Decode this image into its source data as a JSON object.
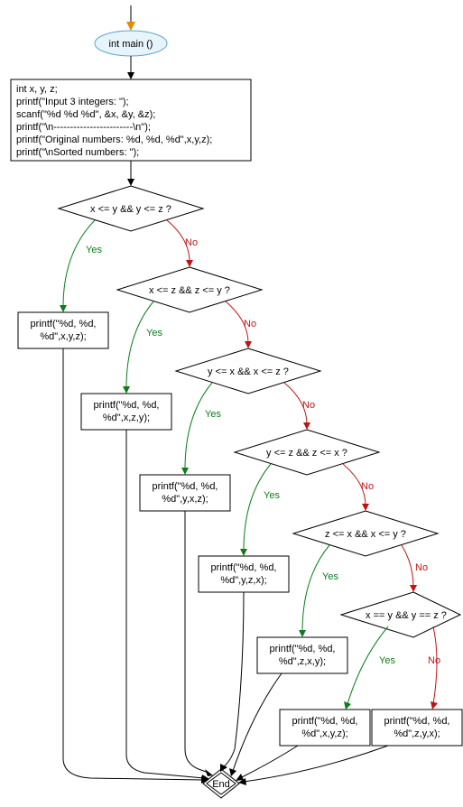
{
  "chart_data": {
    "type": "flowchart",
    "nodes": {
      "start": {
        "shape": "ellipse",
        "text": "int main ()"
      },
      "init": {
        "shape": "rect",
        "text": "int x, y, z;\nprintf(\"Input 3 integers: \");\nscanf(\"%d %d %d\", &x, &y, &z);\nprintf(\"\\n------------------------\\n\");\nprintf(\"Original numbers: %d, %d, %d\",x,y,z);\nprintf(\"\\nSorted numbers: \");"
      },
      "d1": {
        "shape": "diamond",
        "text": "x <= y && y <= z ?"
      },
      "d2": {
        "shape": "diamond",
        "text": "x <= z && z <= y ?"
      },
      "d3": {
        "shape": "diamond",
        "text": "y <= x && x <= z ?"
      },
      "d4": {
        "shape": "diamond",
        "text": "y <= z && z <= x ?"
      },
      "d5": {
        "shape": "diamond",
        "text": "z <= x && x <= y ?"
      },
      "d6": {
        "shape": "diamond",
        "text": "x == y && y == z ?"
      },
      "p1": {
        "shape": "rect",
        "text": "printf(\"%d, %d,\n%d\",x,y,z);"
      },
      "p2": {
        "shape": "rect",
        "text": "printf(\"%d, %d,\n%d\",x,z,y);"
      },
      "p3": {
        "shape": "rect",
        "text": "printf(\"%d, %d,\n%d\",y,x,z);"
      },
      "p4": {
        "shape": "rect",
        "text": "printf(\"%d, %d,\n%d\",y,z,x);"
      },
      "p5": {
        "shape": "rect",
        "text": "printf(\"%d, %d,\n%d\",z,x,y);"
      },
      "p6": {
        "shape": "rect",
        "text": "printf(\"%d, %d,\n%d\",x,y,z);"
      },
      "p7": {
        "shape": "rect",
        "text": "printf(\"%d, %d,\n%d\",z,y,x);"
      },
      "end": {
        "shape": "diamond-small",
        "text": "End"
      }
    },
    "edges": [
      {
        "from": "entry",
        "to": "start",
        "label": ""
      },
      {
        "from": "start",
        "to": "init",
        "label": ""
      },
      {
        "from": "init",
        "to": "d1",
        "label": ""
      },
      {
        "from": "d1",
        "to": "p1",
        "label": "Yes"
      },
      {
        "from": "d1",
        "to": "d2",
        "label": "No"
      },
      {
        "from": "d2",
        "to": "p2",
        "label": "Yes"
      },
      {
        "from": "d2",
        "to": "d3",
        "label": "No"
      },
      {
        "from": "d3",
        "to": "p3",
        "label": "Yes"
      },
      {
        "from": "d3",
        "to": "d4",
        "label": "No"
      },
      {
        "from": "d4",
        "to": "p4",
        "label": "Yes"
      },
      {
        "from": "d4",
        "to": "d5",
        "label": "No"
      },
      {
        "from": "d5",
        "to": "p5",
        "label": "Yes"
      },
      {
        "from": "d5",
        "to": "d6",
        "label": "No"
      },
      {
        "from": "d6",
        "to": "p6",
        "label": "Yes"
      },
      {
        "from": "d6",
        "to": "p7",
        "label": "No"
      },
      {
        "from": "p1",
        "to": "end",
        "label": ""
      },
      {
        "from": "p2",
        "to": "end",
        "label": ""
      },
      {
        "from": "p3",
        "to": "end",
        "label": ""
      },
      {
        "from": "p4",
        "to": "end",
        "label": ""
      },
      {
        "from": "p5",
        "to": "end",
        "label": ""
      },
      {
        "from": "p6",
        "to": "end",
        "label": ""
      },
      {
        "from": "p7",
        "to": "end",
        "label": ""
      }
    ]
  },
  "labels": {
    "yes": "Yes",
    "no": "No"
  },
  "nodes": {
    "start": "int main ()",
    "init_l1": "int x, y, z;",
    "init_l2": "printf(\"Input 3 integers: \");",
    "init_l3": "scanf(\"%d %d %d\", &x, &y, &z);",
    "init_l4": "printf(\"\\n------------------------\\n\");",
    "init_l5": "printf(\"Original numbers: %d, %d, %d\",x,y,z);",
    "init_l6": "printf(\"\\nSorted numbers: \");",
    "d1": "x <= y && y <= z ?",
    "d2": "x <= z && z <= y ?",
    "d3": "y <= x && x <= z ?",
    "d4": "y <= z && z <= x ?",
    "d5": "z <= x && x <= y ?",
    "d6": "x == y && y == z ?",
    "p1_l1": "printf(\"%d, %d,",
    "p1_l2": "%d\",x,y,z);",
    "p2_l1": "printf(\"%d, %d,",
    "p2_l2": "%d\",x,z,y);",
    "p3_l1": "printf(\"%d, %d,",
    "p3_l2": "%d\",y,x,z);",
    "p4_l1": "printf(\"%d, %d,",
    "p4_l2": "%d\",y,z,x);",
    "p5_l1": "printf(\"%d, %d,",
    "p5_l2": "%d\",z,x,y);",
    "p6_l1": "printf(\"%d, %d,",
    "p6_l2": "%d\",x,y,z);",
    "p7_l1": "printf(\"%d, %d,",
    "p7_l2": "%d\",z,y,x);",
    "end": "End"
  }
}
